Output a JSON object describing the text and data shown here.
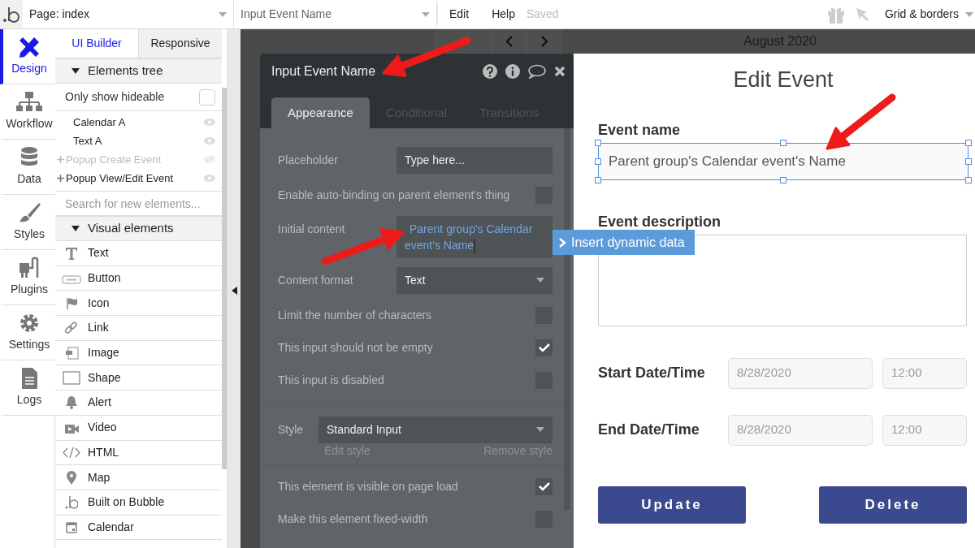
{
  "top_bar": {
    "page_selector": "Page: index",
    "element_selector": "Input Event Name",
    "menu": [
      "Edit",
      "Help"
    ],
    "save_status": "Saved",
    "view_selector": "Grid & borders"
  },
  "rail": [
    {
      "label": "Design",
      "kind": "design",
      "selected": true
    },
    {
      "label": "Workflow",
      "kind": "workflow",
      "selected": false
    },
    {
      "label": "Data",
      "kind": "data",
      "selected": false
    },
    {
      "label": "Styles",
      "kind": "styles",
      "selected": false
    },
    {
      "label": "Plugins",
      "kind": "plugins",
      "selected": false
    },
    {
      "label": "Settings",
      "kind": "settings",
      "selected": false
    },
    {
      "label": "Logs",
      "kind": "logs",
      "selected": false
    }
  ],
  "panel": {
    "tabs": [
      {
        "label": "UI Builder",
        "selected": true
      },
      {
        "label": "Responsive",
        "selected": false
      }
    ],
    "elements_tree": {
      "title": "Elements tree",
      "expanded": true,
      "filter_label": "Only show hideable",
      "filter_checked": false,
      "items": [
        {
          "label": "Calendar A",
          "hidden": false,
          "has_children": false
        },
        {
          "label": "Text A",
          "hidden": false,
          "has_children": false
        },
        {
          "label": "Popup Create Event",
          "hidden": true,
          "has_children": true
        },
        {
          "label": "Popup View/Edit Event",
          "hidden": false,
          "has_children": true
        }
      ]
    },
    "search": {
      "placeholder": "Search for new elements..."
    },
    "visual_elements": {
      "title": "Visual elements",
      "expanded": true,
      "items": [
        {
          "label": "Text",
          "kind": "text"
        },
        {
          "label": "Button",
          "kind": "button"
        },
        {
          "label": "Icon",
          "kind": "icon"
        },
        {
          "label": "Link",
          "kind": "link"
        },
        {
          "label": "Image",
          "kind": "image"
        },
        {
          "label": "Shape",
          "kind": "shape"
        },
        {
          "label": "Alert",
          "kind": "alert"
        },
        {
          "label": "Video",
          "kind": "video"
        },
        {
          "label": "HTML",
          "kind": "html"
        },
        {
          "label": "Map",
          "kind": "map"
        },
        {
          "label": "Built on Bubble",
          "kind": "bubble"
        },
        {
          "label": "Calendar",
          "kind": "calendar"
        }
      ]
    }
  },
  "calendar_header": {
    "month": "August 2020"
  },
  "property_editor": {
    "title": "Input Event Name",
    "tabs": [
      {
        "label": "Appearance",
        "selected": true
      },
      {
        "label": "Conditional",
        "selected": false
      },
      {
        "label": "Transitions",
        "selected": false
      }
    ],
    "rows": [
      {
        "kind": "text",
        "label": "Placeholder",
        "value": "Type here..."
      },
      {
        "kind": "checkbox",
        "label": "Enable auto-binding on parent element's thing",
        "checked": false
      },
      {
        "kind": "dynamic",
        "label": "Initial content",
        "value": "Parent group's Calendar event's Name"
      },
      {
        "kind": "dropdown",
        "label": "Content format",
        "value": "Text"
      },
      {
        "kind": "checkbox",
        "label": "Limit the number of characters",
        "checked": false
      },
      {
        "kind": "checkbox",
        "label": "This input should not be empty",
        "checked": true
      },
      {
        "kind": "checkbox",
        "label": "This input is disabled",
        "checked": false
      },
      {
        "kind": "style",
        "label": "Style",
        "value": "Standard Input",
        "edit_link": "Edit style",
        "remove_link": "Remove style"
      },
      {
        "kind": "checkbox",
        "label": "This element is visible on page load",
        "checked": true
      },
      {
        "kind": "checkbox",
        "label": "Make this element fixed-width",
        "checked": false
      }
    ]
  },
  "tooltip": "Insert dynamic data",
  "popup": {
    "title": "Edit Event",
    "event_name": {
      "label": "Event name",
      "value": "Parent group's Calendar event's Name",
      "selected": true
    },
    "description": {
      "label": "Event description"
    },
    "date_rows": [
      {
        "label": "Start Date/Time",
        "date": "8/28/2020",
        "time": "12:00"
      },
      {
        "label": "End Date/Time",
        "date": "8/28/2020",
        "time": "12:00"
      }
    ],
    "buttons": [
      "Update",
      "Delete"
    ]
  }
}
